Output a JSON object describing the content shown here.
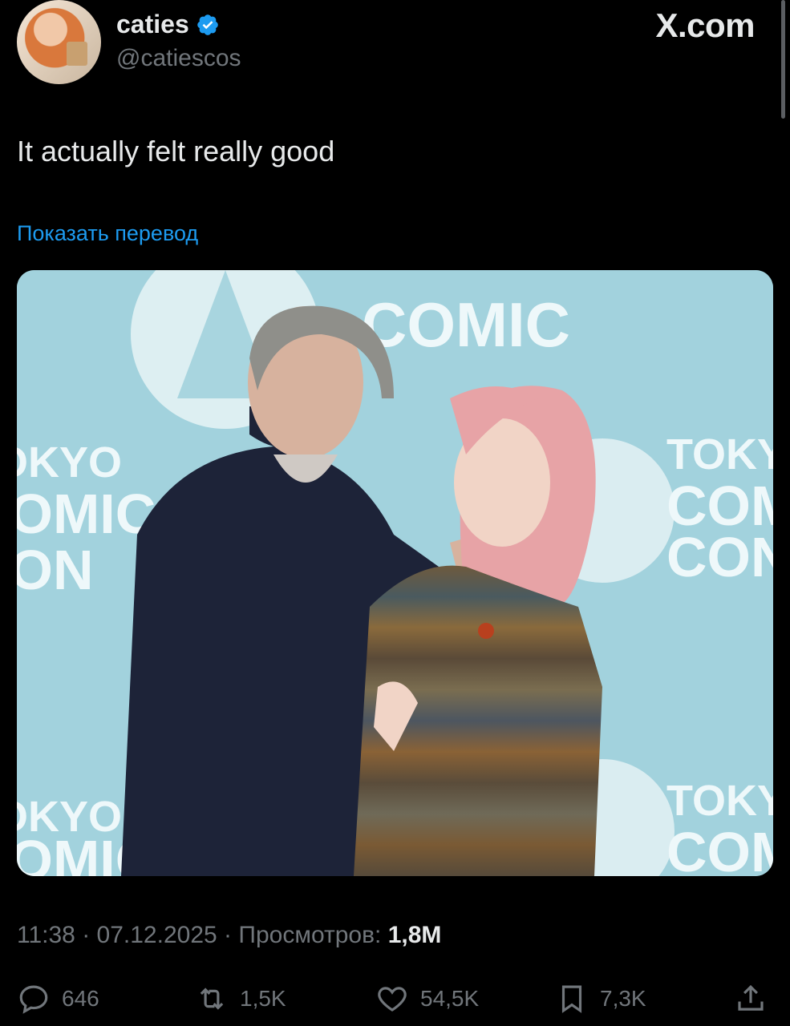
{
  "author": {
    "display_name": "caties",
    "handle": "@catiescos",
    "verified": true,
    "verified_color": "#1d9bf0"
  },
  "site_label": "X.com",
  "tweet": {
    "text": "It actually felt really good",
    "translate_link": "Показать перевод",
    "link_color": "#1d9bf0"
  },
  "media": {
    "backdrop_text": [
      "TOKYO",
      "COMIC",
      "CON"
    ],
    "backdrop_color": "#9fcfdb"
  },
  "meta": {
    "time": "11:38",
    "date": "07.12.2025",
    "views_label": "Просмотров:",
    "views_count": "1,8M",
    "separator": "·"
  },
  "actions": {
    "replies": "646",
    "reposts": "1,5K",
    "likes": "54,5K",
    "bookmarks": "7,3K"
  },
  "icons": [
    "verified-badge-icon",
    "reply-icon",
    "repost-icon",
    "like-icon",
    "bookmark-icon",
    "share-icon"
  ]
}
